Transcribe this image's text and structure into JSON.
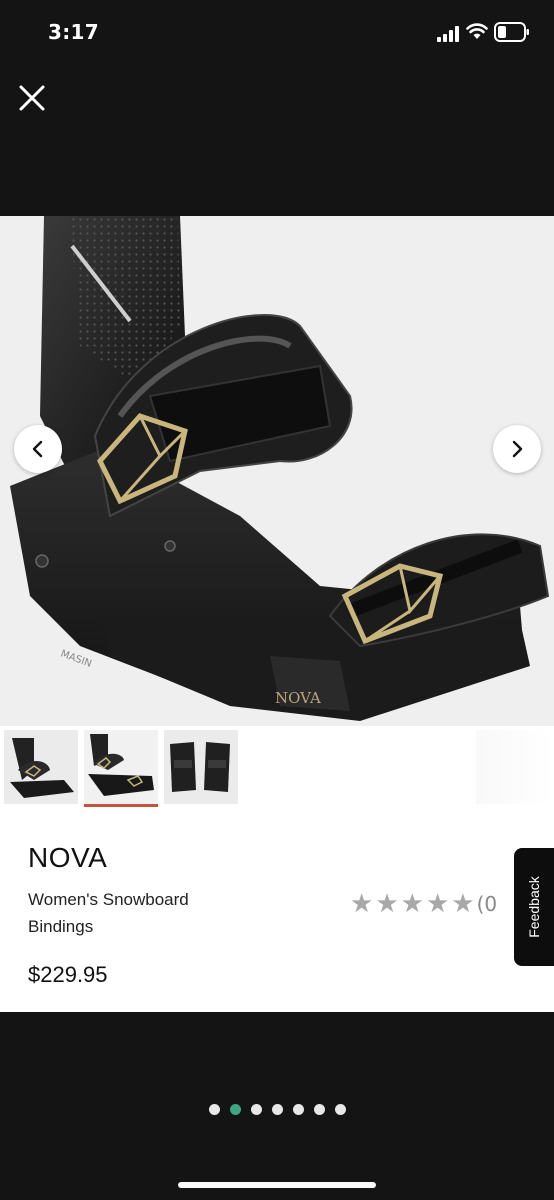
{
  "status_bar": {
    "time": "3:17"
  },
  "product": {
    "name": "NOVA",
    "subtitle": "Women's Snowboard Bindings",
    "price": "$229.95",
    "logo_text": "NOVA",
    "brand_text": "MASIN",
    "rating": {
      "stars_filled": 0,
      "stars_total": 5,
      "count_visible": "(0"
    }
  },
  "gallery": {
    "thumbnails": [
      "thumb-front-view",
      "thumb-side-view",
      "thumb-back-view"
    ],
    "selected_thumbnail": 2,
    "pager_dots": 7,
    "active_dot": 2
  },
  "feedback": {
    "label": "Feedback"
  },
  "icons": {
    "close": "close-icon",
    "prev": "chevron-left-icon",
    "next": "chevron-right-icon",
    "star": "star-icon"
  },
  "colors": {
    "background": "#141414",
    "accent_dot": "#3ea682",
    "thumb_underline": "#c8533c",
    "star": "#a8a8a8"
  }
}
